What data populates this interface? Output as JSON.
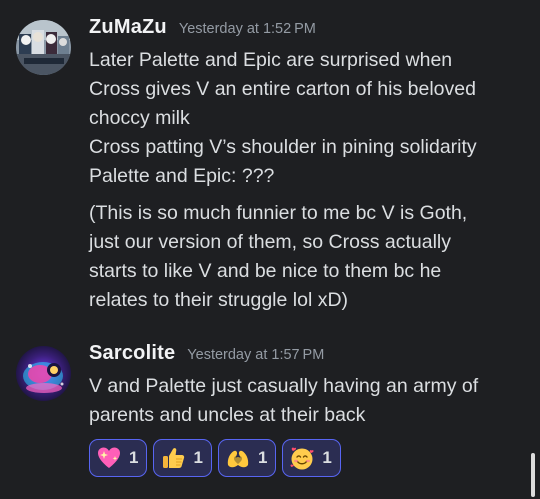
{
  "messages": [
    {
      "username": "ZuMaZu",
      "timestamp": "Yesterday at 1:52 PM",
      "lines": [
        "Later Palette and Epic are surprised when",
        "Cross gives V an entire carton of his beloved",
        "choccy milk",
        "Cross patting V’s shoulder in pining solidarity",
        "Palette and Epic: ???"
      ],
      "lines2": [
        "(This is so much funnier to me bc V is Goth,",
        "just our version of them, so Cross actually",
        "starts to like V and be nice to them bc he",
        "relates to their struggle lol  xD)"
      ]
    },
    {
      "username": "Sarcolite",
      "timestamp": "Yesterday at 1:57 PM",
      "lines": [
        "V and Palette just casually having an army of",
        "parents and uncles at their back"
      ]
    }
  ],
  "reactions": [
    {
      "emoji": "sparkling-heart",
      "count": "1"
    },
    {
      "emoji": "thumbs-up",
      "count": "1"
    },
    {
      "emoji": "heart-hands",
      "count": "1"
    },
    {
      "emoji": "smiling-face-with-hearts",
      "count": "1"
    }
  ],
  "colors": {
    "background": "#1e1f22",
    "username": "#f2f3f5",
    "timestamp": "#949ba4",
    "text": "#dbdee1",
    "reaction_border": "#5865f2",
    "reaction_bg": "#2b2d52"
  }
}
